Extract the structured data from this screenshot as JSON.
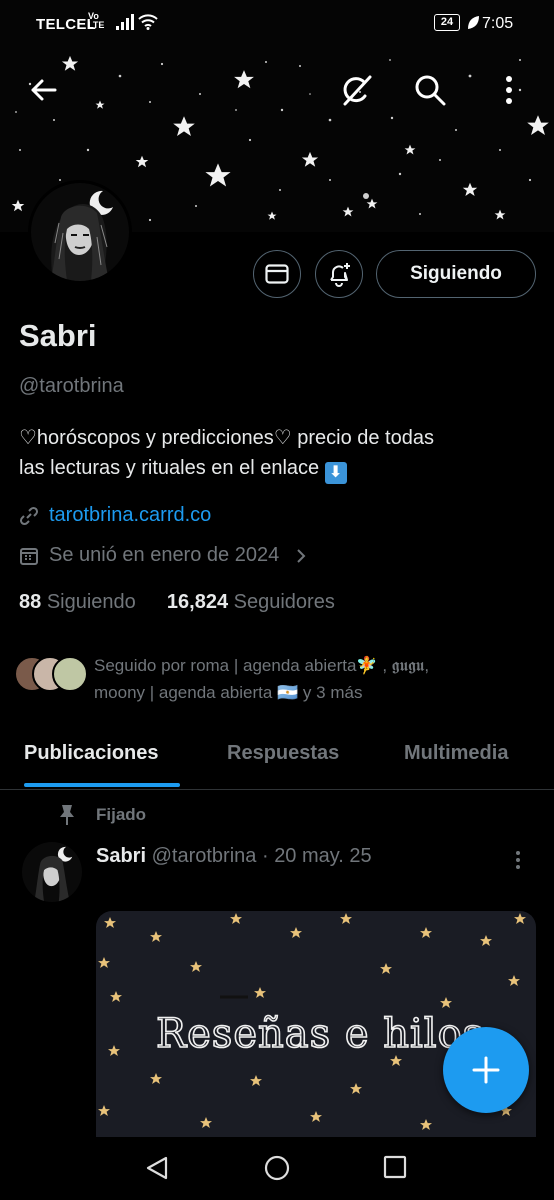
{
  "status_bar": {
    "carrier": "TELCEL",
    "volte_top": "Vo",
    "volte_bottom": "LTE",
    "battery": "24",
    "time": "7:05"
  },
  "icons": {
    "back": "arrow-left-icon",
    "grok": "grok-icon",
    "search": "search-icon",
    "more": "more-vertical-icon",
    "message": "envelope-icon",
    "notify": "bell-plus-icon",
    "link": "link-icon",
    "calendar": "calendar-icon",
    "chevron": "chevron-right-icon",
    "pin": "pin-icon",
    "compose": "plus-icon"
  },
  "profile": {
    "follow_button": "Siguiendo",
    "name": "Sabri",
    "handle": "@tarotbrina",
    "bio_line1": "♡horóscopos y predicciones♡ precio de todas",
    "bio_line2": "las lecturas y rituales en el enlace",
    "bio_emoji": "⬇",
    "link": "tarotbrina.carrd.co",
    "joined": "Se unió en enero de 2024",
    "following_count": "88",
    "following_label": "Siguiendo",
    "followers_count": "16,824",
    "followers_label": "Seguidores",
    "followed_by_line1": "Seguido por roma | agenda abierta🧚 , 𝖌𝖚𝖌𝖚,",
    "followed_by_line2": "moony | agenda abierta 🇦🇷 y 3 más"
  },
  "tabs": [
    "Publicaciones",
    "Respuestas",
    "Multimedia"
  ],
  "post": {
    "pinned_label": "Fijado",
    "author": "Sabri",
    "handle": "@tarotbrina",
    "separator": "·",
    "date": "20 may. 25",
    "media_text": "Reseñas e hilos"
  },
  "colors": {
    "accent": "#1d9bf0",
    "background": "#000000",
    "text": "#e7e9ea",
    "muted": "#71767b"
  }
}
